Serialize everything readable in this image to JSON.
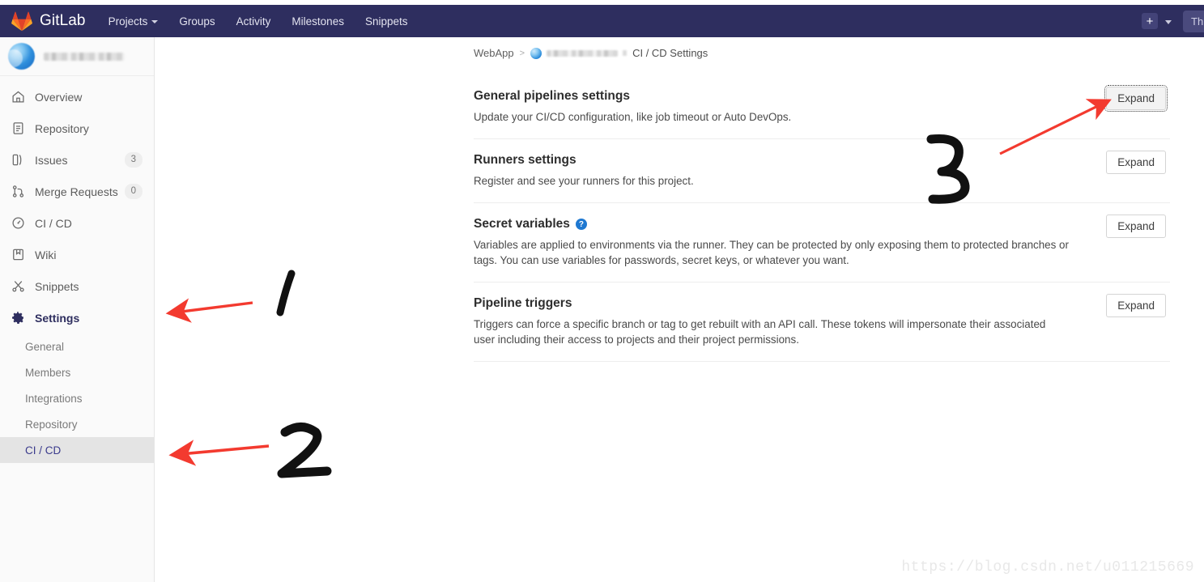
{
  "navbar": {
    "brand": "GitLab",
    "logo_icon": "gitlab-tanuki-icon",
    "links": [
      {
        "label": "Projects",
        "has_caret": true
      },
      {
        "label": "Groups",
        "has_caret": false
      },
      {
        "label": "Activity",
        "has_caret": false
      },
      {
        "label": "Milestones",
        "has_caret": false
      },
      {
        "label": "Snippets",
        "has_caret": false
      }
    ],
    "new_icon": "plus-icon",
    "new_caret_icon": "chevron-down-icon",
    "truncated_button": "This"
  },
  "sidebar": {
    "project_name": "",
    "avatar_icon": "project-avatar",
    "items": [
      {
        "label": "Overview",
        "icon": "home-icon",
        "badge": ""
      },
      {
        "label": "Repository",
        "icon": "document-icon",
        "badge": ""
      },
      {
        "label": "Issues",
        "icon": "issues-icon",
        "badge": "3"
      },
      {
        "label": "Merge Requests",
        "icon": "merge-request-icon",
        "badge": "0"
      },
      {
        "label": "CI / CD",
        "icon": "rocket-icon",
        "badge": ""
      },
      {
        "label": "Wiki",
        "icon": "book-icon",
        "badge": ""
      },
      {
        "label": "Snippets",
        "icon": "scissors-icon",
        "badge": ""
      },
      {
        "label": "Settings",
        "icon": "gear-icon",
        "badge": "",
        "active": true
      }
    ],
    "settings_sub_items": [
      {
        "label": "General",
        "active": false
      },
      {
        "label": "Members",
        "active": false
      },
      {
        "label": "Integrations",
        "active": false
      },
      {
        "label": "Repository",
        "active": false
      },
      {
        "label": "CI / CD",
        "active": true
      }
    ]
  },
  "breadcrumb": {
    "root": "WebApp",
    "separator": ">",
    "project": "",
    "current": "CI / CD Settings"
  },
  "main": {
    "sections": [
      {
        "title": "General pipelines settings",
        "description": "Update your CI/CD configuration, like job timeout or Auto DevOps.",
        "button": "Expand",
        "has_help": false,
        "focused": true
      },
      {
        "title": "Runners settings",
        "description": "Register and see your runners for this project.",
        "button": "Expand",
        "has_help": false,
        "focused": false
      },
      {
        "title": "Secret variables",
        "description": "Variables are applied to environments via the runner. They can be protected by only exposing them to protected branches or tags. You can use variables for passwords, secret keys, or whatever you want.",
        "button": "Expand",
        "has_help": true,
        "help_icon": "question-help-icon",
        "focused": false
      },
      {
        "title": "Pipeline triggers",
        "description": "Triggers can force a specific branch or tag to get rebuilt with an API call. These tokens will impersonate their associated user including their access to projects and their project permissions.",
        "button": "Expand",
        "has_help": false,
        "focused": false
      }
    ]
  },
  "annotations": {
    "accent_color": "#f33a2f",
    "marks": [
      {
        "label": "1",
        "target": "sidebar-item-settings"
      },
      {
        "label": "2",
        "target": "sidebar-subitem-ci-cd"
      },
      {
        "label": "3",
        "target": "general-pipelines-expand-button"
      }
    ]
  },
  "watermark": "https://blog.csdn.net/u011215669"
}
